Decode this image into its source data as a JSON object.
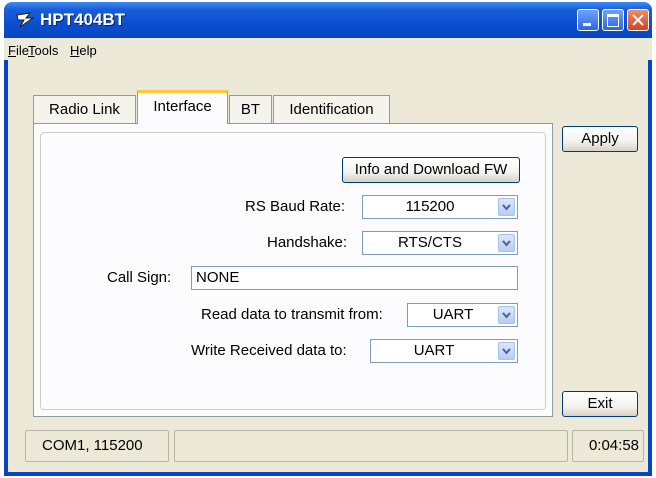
{
  "window": {
    "title": "HPT404BT",
    "colors": {
      "titlebar": "#0a4fd0",
      "face": "#ece9d8",
      "tab_accent": "#ffc83c"
    }
  },
  "menubar": {
    "items": [
      {
        "accel": "F",
        "rest": "ile"
      },
      {
        "accel": "T",
        "rest": "ools"
      },
      {
        "accel": "H",
        "rest": "elp"
      }
    ]
  },
  "tabs": [
    {
      "label": "Radio Link",
      "active": false
    },
    {
      "label": "Interface",
      "active": true
    },
    {
      "label": "BT",
      "active": false
    },
    {
      "label": "Identification",
      "active": false
    }
  ],
  "interface": {
    "info_button": "Info and Download FW",
    "baud": {
      "label": "RS Baud Rate:",
      "value": "115200"
    },
    "handshake": {
      "label": "Handshake:",
      "value": "RTS/CTS"
    },
    "callsign": {
      "label": "Call Sign:",
      "value": "NONE"
    },
    "read_from": {
      "label": "Read data to transmit from:",
      "value": "UART"
    },
    "write_to": {
      "label": "Write Received data to:",
      "value": "UART"
    }
  },
  "buttons": {
    "apply": "Apply",
    "exit": "Exit"
  },
  "statusbar": {
    "connection": "COM1, 115200",
    "middle": "",
    "time": "0:04:58"
  },
  "icons": {
    "app": "lightning-app-icon",
    "dropdown": "chevron-down-icon"
  }
}
